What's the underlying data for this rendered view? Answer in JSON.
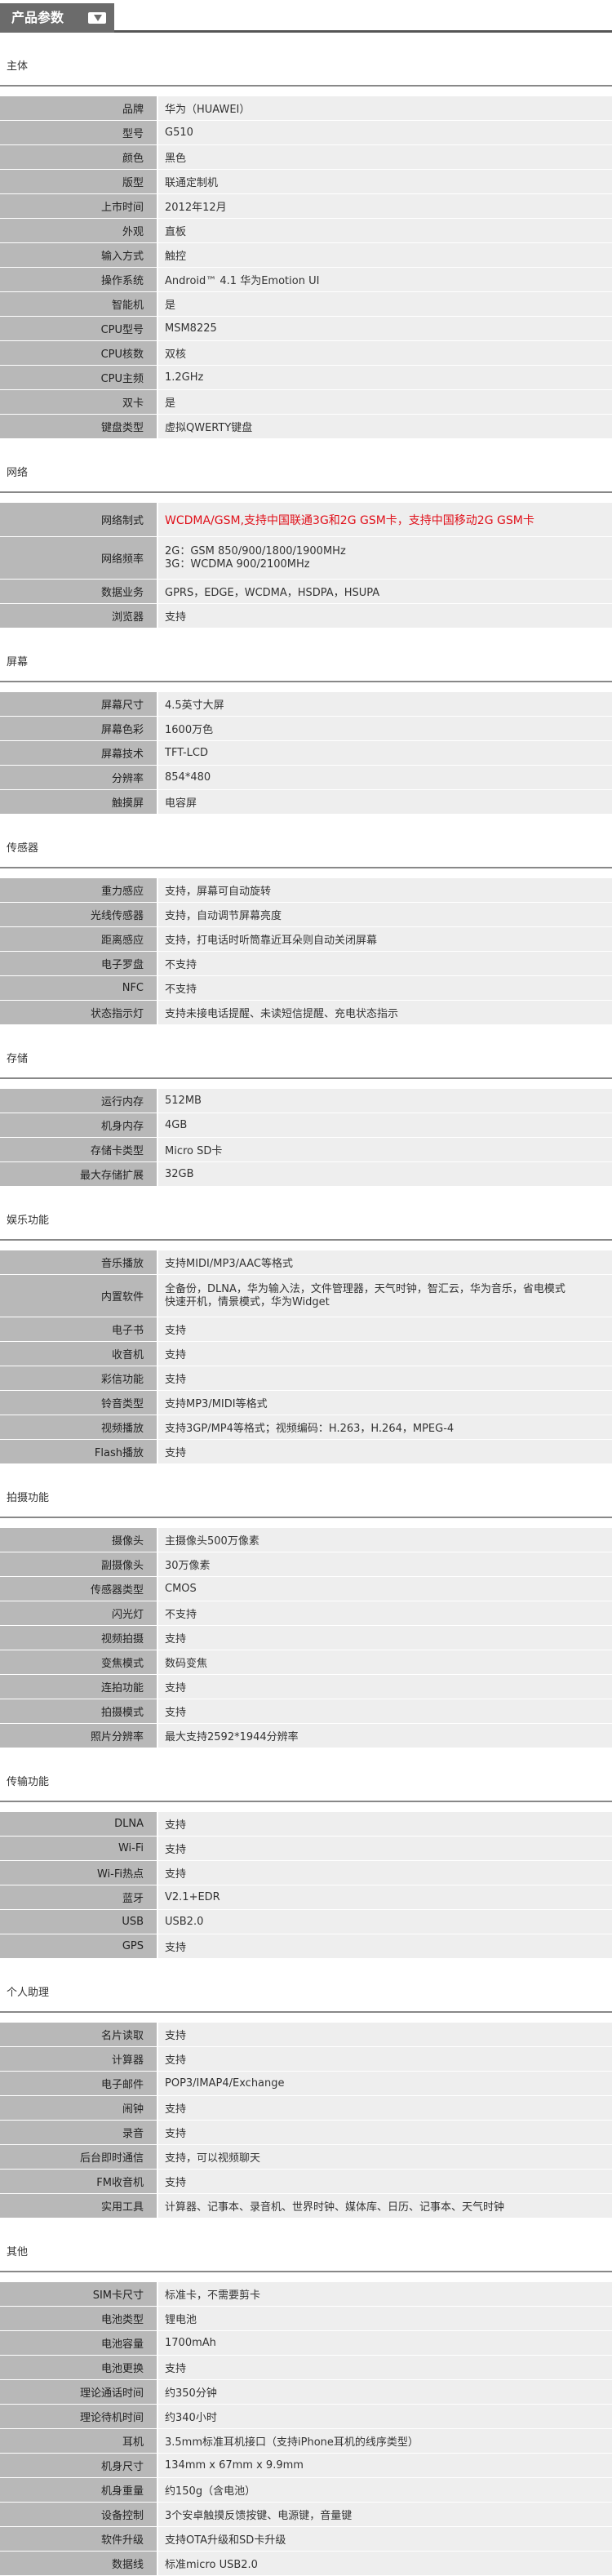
{
  "header": {
    "title": "产品参数"
  },
  "sections": [
    {
      "title": "主体",
      "rows": [
        {
          "label": "品牌",
          "value": "华为（HUAWEI）"
        },
        {
          "label": "型号",
          "value": "G510"
        },
        {
          "label": "颜色",
          "value": "黑色"
        },
        {
          "label": "版型",
          "value": "联通定制机"
        },
        {
          "label": "上市时间",
          "value": "2012年12月"
        },
        {
          "label": "外观",
          "value": "直板"
        },
        {
          "label": "输入方式",
          "value": "触控"
        },
        {
          "label": "操作系统",
          "value": "Android™ 4.1 华为Emotion UI"
        },
        {
          "label": "智能机",
          "value": "是"
        },
        {
          "label": "CPU型号",
          "value": "MSM8225"
        },
        {
          "label": "CPU核数",
          "value": "双核"
        },
        {
          "label": "CPU主频",
          "value": "1.2GHz"
        },
        {
          "label": "双卡",
          "value": "是"
        },
        {
          "label": "键盘类型",
          "value": "虚拟QWERTY键盘"
        }
      ]
    },
    {
      "title": "网络",
      "rows": [
        {
          "label": "网络制式",
          "value": "WCDMA/GSM,支持中国联通3G和2G GSM卡，支持中国移动2G GSM卡",
          "style": "red"
        },
        {
          "label": "网络频率",
          "lines": [
            "2G：GSM 850/900/1800/1900MHz",
            "3G：WCDMA 900/2100MHz"
          ]
        },
        {
          "label": "数据业务",
          "value": "GPRS，EDGE，WCDMA，HSDPA，HSUPA"
        },
        {
          "label": "浏览器",
          "value": "支持"
        }
      ]
    },
    {
      "title": "屏幕",
      "rows": [
        {
          "label": "屏幕尺寸",
          "value": "4.5英寸大屏"
        },
        {
          "label": "屏幕色彩",
          "value": "1600万色"
        },
        {
          "label": "屏幕技术",
          "value": "TFT-LCD"
        },
        {
          "label": "分辨率",
          "value": "854*480"
        },
        {
          "label": "触摸屏",
          "value": "电容屏"
        }
      ]
    },
    {
      "title": "传感器",
      "rows": [
        {
          "label": "重力感应",
          "value": "支持，屏幕可自动旋转"
        },
        {
          "label": "光线传感器",
          "value": "支持，自动调节屏幕亮度"
        },
        {
          "label": "距离感应",
          "value": "支持，打电话时听筒靠近耳朵则自动关闭屏幕"
        },
        {
          "label": "电子罗盘",
          "value": "不支持"
        },
        {
          "label": "NFC",
          "value": "不支持"
        },
        {
          "label": "状态指示灯",
          "value": "支持未接电话提醒、未读短信提醒、充电状态指示"
        }
      ]
    },
    {
      "title": "存储",
      "rows": [
        {
          "label": "运行内存",
          "value": "512MB"
        },
        {
          "label": "机身内存",
          "value": "4GB"
        },
        {
          "label": "存储卡类型",
          "value": "Micro SD卡"
        },
        {
          "label": "最大存储扩展",
          "value": "32GB"
        }
      ]
    },
    {
      "title": "娱乐功能",
      "rows": [
        {
          "label": "音乐播放",
          "value": "支持MIDI/MP3/AAC等格式"
        },
        {
          "label": "内置软件",
          "lines": [
            "全备份，DLNA，华为输入法，文件管理器，天气时钟，智汇云，华为音乐，省电模式",
            "快速开机，情景模式，华为Widget"
          ]
        },
        {
          "label": "电子书",
          "value": "支持"
        },
        {
          "label": "收音机",
          "value": "支持"
        },
        {
          "label": "彩信功能",
          "value": "支持"
        },
        {
          "label": "铃音类型",
          "value": "支持MP3/MIDI等格式"
        },
        {
          "label": "视频播放",
          "value": "支持3GP/MP4等格式；视频编码：H.263，H.264，MPEG-4"
        },
        {
          "label": "Flash播放",
          "value": "支持"
        }
      ]
    },
    {
      "title": "拍摄功能",
      "rows": [
        {
          "label": "摄像头",
          "value": "主摄像头500万像素"
        },
        {
          "label": "副摄像头",
          "value": "30万像素"
        },
        {
          "label": "传感器类型",
          "value": "CMOS"
        },
        {
          "label": "闪光灯",
          "value": "不支持"
        },
        {
          "label": "视频拍摄",
          "value": "支持"
        },
        {
          "label": "变焦模式",
          "value": "数码变焦"
        },
        {
          "label": "连拍功能",
          "value": "支持"
        },
        {
          "label": "拍摄模式",
          "value": "支持"
        },
        {
          "label": "照片分辨率",
          "value": "最大支持2592*1944分辨率"
        }
      ]
    },
    {
      "title": "传输功能",
      "rows": [
        {
          "label": "DLNA",
          "value": "支持"
        },
        {
          "label": "Wi-Fi",
          "value": "支持"
        },
        {
          "label": "Wi-Fi热点",
          "value": "支持"
        },
        {
          "label": "蓝牙",
          "value": "V2.1+EDR"
        },
        {
          "label": "USB",
          "value": "USB2.0"
        },
        {
          "label": "GPS",
          "value": "支持"
        }
      ]
    },
    {
      "title": "个人助理",
      "rows": [
        {
          "label": "名片读取",
          "value": "支持"
        },
        {
          "label": "计算器",
          "value": "支持"
        },
        {
          "label": "电子邮件",
          "value": "POP3/IMAP4/Exchange"
        },
        {
          "label": "闹钟",
          "value": "支持"
        },
        {
          "label": "录音",
          "value": "支持"
        },
        {
          "label": "后台即时通信",
          "value": "支持，可以视频聊天"
        },
        {
          "label": "FM收音机",
          "value": "支持"
        },
        {
          "label": "实用工具",
          "value": "计算器、记事本、录音机、世界时钟、媒体库、日历、记事本、天气时钟"
        }
      ]
    },
    {
      "title": "其他",
      "rows": [
        {
          "label": "SIM卡尺寸",
          "value": "标准卡，不需要剪卡"
        },
        {
          "label": "电池类型",
          "value": "锂电池"
        },
        {
          "label": "电池容量",
          "value": "1700mAh"
        },
        {
          "label": "电池更换",
          "value": "支持"
        },
        {
          "label": "理论通话时间",
          "value": "约350分钟"
        },
        {
          "label": "理论待机时间",
          "value": "约340小时"
        },
        {
          "label": "耳机",
          "value": "3.5mm标准耳机接口（支持iPhone耳机的线序类型）"
        },
        {
          "label": "机身尺寸",
          "value": "134mm x 67mm x 9.9mm"
        },
        {
          "label": "机身重量",
          "value": "约150g（含电池）"
        },
        {
          "label": "设备控制",
          "value": "3个安卓触摸反馈按键、电源键，音量键"
        },
        {
          "label": "软件升级",
          "value": "支持OTA升级和SD卡升级"
        },
        {
          "label": "数据线",
          "value": "标准micro USB2.0"
        }
      ]
    }
  ]
}
